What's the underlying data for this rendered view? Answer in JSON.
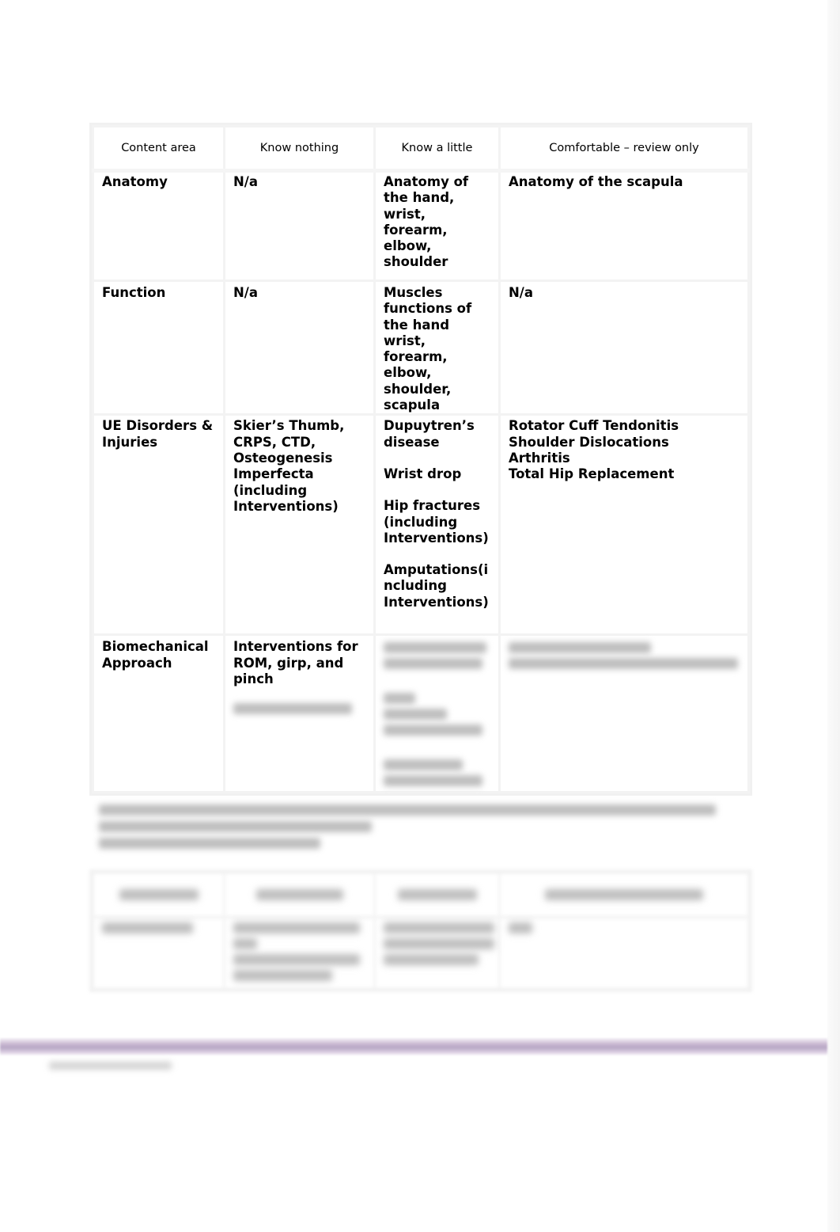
{
  "table1": {
    "headers": [
      "Content area",
      "Know nothing",
      "Know a little",
      "Comfortable – review only"
    ],
    "rows": [
      {
        "content_area": "Anatomy",
        "know_nothing": "N/a",
        "know_a_little": "Anatomy of the hand, wrist, forearm, elbow, shoulder",
        "comfortable": "Anatomy of the scapula"
      },
      {
        "content_area": "Function",
        "know_nothing": "N/a",
        "know_a_little": "Muscles functions of the hand wrist, forearm, elbow, shoulder, scapula",
        "comfortable": "N/a"
      },
      {
        "content_area": "UE Disorders & Injuries",
        "know_nothing": "Skier’s Thumb, CRPS, CTD, Osteogenesis Imperfecta (including Interventions)",
        "know_a_little": [
          "Dupuytren’s disease",
          "Wrist drop",
          "Hip fractures (including Interventions)",
          "Amputations(including Interventions)"
        ],
        "comfortable": [
          "Rotator Cuff Tendonitis",
          "Shoulder Dislocations",
          "Arthritis",
          "Total Hip Replacement"
        ]
      },
      {
        "content_area": "Biomechanical Approach",
        "know_nothing": "Interventions for ROM, girp, and pinch",
        "know_nothing_blurred": "[blurred]",
        "know_a_little": "[blurred]",
        "comfortable": "[blurred]"
      }
    ]
  },
  "blurred_section": {
    "heading": "[blurred]",
    "table2": {
      "headers": [
        "[blurred]",
        "[blurred]",
        "[blurred]",
        "[blurred]"
      ],
      "rows": [
        [
          "[blurred]",
          "[blurred]",
          "[blurred]",
          "[blurred]"
        ]
      ]
    }
  },
  "footer": {
    "text": "[blurred]",
    "band_color": "#b9a8c6"
  }
}
